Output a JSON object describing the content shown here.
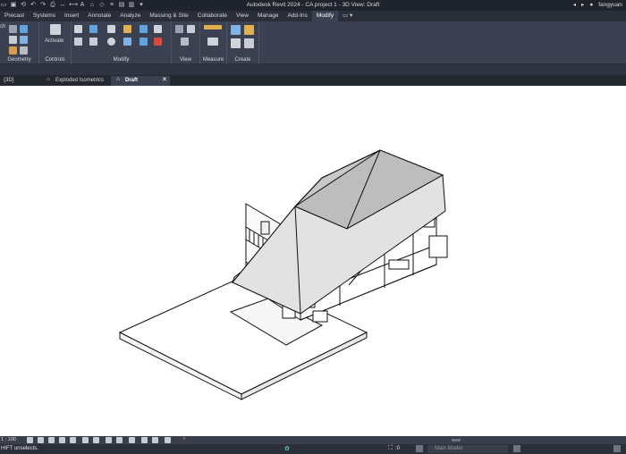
{
  "app": {
    "title": "Autodesk Revit 2024 - CA project 1 - 3D View: Draft",
    "user": "fangyuan"
  },
  "ribbon_tabs": [
    {
      "label": "Precast",
      "active": false
    },
    {
      "label": "Systems",
      "active": false
    },
    {
      "label": "Insert",
      "active": false
    },
    {
      "label": "Annotate",
      "active": false
    },
    {
      "label": "Analyze",
      "active": false
    },
    {
      "label": "Massing & Site",
      "active": false
    },
    {
      "label": "Collaborate",
      "active": false
    },
    {
      "label": "View",
      "active": false
    },
    {
      "label": "Manage",
      "active": false
    },
    {
      "label": "Add-Ins",
      "active": false
    },
    {
      "label": "Modify",
      "active": true
    }
  ],
  "ribbon": {
    "panels": {
      "geometry": "Geometry",
      "controls": "Controls",
      "modify": "Modify",
      "view": "View",
      "measure": "Measure",
      "create": "Create"
    },
    "activate_label": "Activate",
    "partial_label": "ch"
  },
  "doc_tabs": [
    {
      "label": "{3D}",
      "active": false
    },
    {
      "label": "Exploded Isometrics",
      "active": false
    },
    {
      "label": "Draft",
      "active": true
    }
  ],
  "view_control": {
    "scale": "1 : 100"
  },
  "status": {
    "hint": "HIFT unselects.",
    "filter_count": ":0",
    "workset": "Main Model"
  },
  "colors": {
    "ribbon_bg": "#3b4150",
    "title_bg": "#1f232c",
    "canvas_bg": "#ffffff",
    "accent": "#3d8fd6"
  }
}
